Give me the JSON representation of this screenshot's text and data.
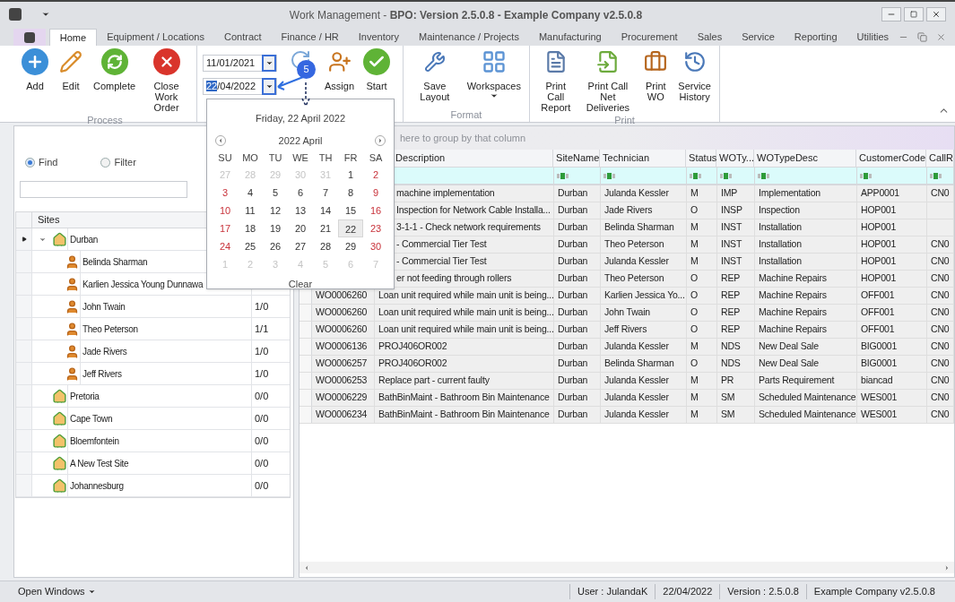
{
  "window": {
    "title": "Work Management - **BPO: Version 2.5.0.8 - Example Company v2.5.0.8**"
  },
  "tabs": [
    {
      "label": "Home",
      "selected": true
    },
    {
      "label": "Equipment / Locations",
      "selected": false
    },
    {
      "label": "Contract",
      "selected": false
    },
    {
      "label": "Finance / HR",
      "selected": false
    },
    {
      "label": "Inventory",
      "selected": false
    },
    {
      "label": "Maintenance / Projects",
      "selected": false
    },
    {
      "label": "Manufacturing",
      "selected": false
    },
    {
      "label": "Procurement",
      "selected": false
    },
    {
      "label": "Sales",
      "selected": false
    },
    {
      "label": "Service",
      "selected": false
    },
    {
      "label": "Reporting",
      "selected": false
    },
    {
      "label": "Utilities",
      "selected": false
    }
  ],
  "ribbon": {
    "process": {
      "label": "Process",
      "buttons": [
        "Add",
        "Edit",
        "Complete",
        "Close Work Order"
      ]
    },
    "dates": {
      "from": "11/01/2021",
      "to": "22/04/2022",
      "to_focused": true,
      "buttons": [
        "Assign",
        "Start"
      ]
    },
    "format": {
      "label": "Format",
      "buttons": [
        "Save Layout",
        "Workspaces"
      ]
    },
    "print": {
      "label": "Print",
      "buttons": [
        "Print Call Report",
        "Print Call Net Deliveries",
        "Print WO",
        "Service History"
      ]
    }
  },
  "callout": {
    "label": "5"
  },
  "search": {
    "options": [
      {
        "label": "Find",
        "selected": true
      },
      {
        "label": "Filter",
        "selected": false
      }
    ]
  },
  "tree": {
    "header": "Sites",
    "items": [
      {
        "name": "Durban",
        "expanded": true,
        "selected": true,
        "children": [
          {
            "name": "Belinda Sharman"
          },
          {
            "name": "Karlien Jessica Young Dunnawa"
          },
          {
            "name": "John Twain",
            "count": "1/0"
          },
          {
            "name": "Theo Peterson",
            "count": "1/1"
          },
          {
            "name": "Jade Rivers",
            "count": "1/0"
          },
          {
            "name": "Jeff Rivers",
            "count": "1/0"
          }
        ]
      },
      {
        "name": "Pretoria",
        "count": "0/0",
        "expanded": false,
        "selected": false
      },
      {
        "name": "Cape Town",
        "count": "0/0",
        "expanded": false,
        "selected": false
      },
      {
        "name": "Bloemfontein",
        "count": "0/0",
        "expanded": false,
        "selected": false
      },
      {
        "name": "A New Test Site",
        "count": "0/0",
        "expanded": false,
        "selected": false
      },
      {
        "name": "Johannesburg",
        "count": "0/0",
        "expanded": false,
        "selected": false
      }
    ]
  },
  "calendar": {
    "title": "Friday, 22 April 2022",
    "month": "2022 April",
    "weekdays": [
      "SU",
      "MO",
      "TU",
      "WE",
      "TH",
      "FR",
      "SA"
    ],
    "clear": "Clear",
    "weeks": [
      [
        {
          "d": "27",
          "kind": "other"
        },
        {
          "d": "28",
          "kind": "other"
        },
        {
          "d": "29",
          "kind": "other"
        },
        {
          "d": "30",
          "kind": "other"
        },
        {
          "d": "31",
          "kind": "other"
        },
        {
          "d": "1",
          "kind": "day"
        },
        {
          "d": "2",
          "kind": "weekend"
        }
      ],
      [
        {
          "d": "3",
          "kind": "weekend"
        },
        {
          "d": "4",
          "kind": "day"
        },
        {
          "d": "5",
          "kind": "day"
        },
        {
          "d": "6",
          "kind": "day"
        },
        {
          "d": "7",
          "kind": "day"
        },
        {
          "d": "8",
          "kind": "day"
        },
        {
          "d": "9",
          "kind": "weekend"
        }
      ],
      [
        {
          "d": "10",
          "kind": "weekend"
        },
        {
          "d": "11",
          "kind": "day"
        },
        {
          "d": "12",
          "kind": "day"
        },
        {
          "d": "13",
          "kind": "day"
        },
        {
          "d": "14",
          "kind": "day"
        },
        {
          "d": "15",
          "kind": "day"
        },
        {
          "d": "16",
          "kind": "weekend"
        }
      ],
      [
        {
          "d": "17",
          "kind": "weekend"
        },
        {
          "d": "18",
          "kind": "day"
        },
        {
          "d": "19",
          "kind": "day"
        },
        {
          "d": "20",
          "kind": "day"
        },
        {
          "d": "21",
          "kind": "day"
        },
        {
          "d": "22",
          "kind": "day",
          "selected": true
        },
        {
          "d": "23",
          "kind": "weekend"
        }
      ],
      [
        {
          "d": "24",
          "kind": "weekend"
        },
        {
          "d": "25",
          "kind": "day"
        },
        {
          "d": "26",
          "kind": "day"
        },
        {
          "d": "27",
          "kind": "day"
        },
        {
          "d": "28",
          "kind": "day"
        },
        {
          "d": "29",
          "kind": "day"
        },
        {
          "d": "30",
          "kind": "weekend"
        }
      ],
      [
        {
          "d": "1",
          "kind": "other"
        },
        {
          "d": "2",
          "kind": "other"
        },
        {
          "d": "3",
          "kind": "other"
        },
        {
          "d": "4",
          "kind": "other"
        },
        {
          "d": "5",
          "kind": "other"
        },
        {
          "d": "6",
          "kind": "other"
        },
        {
          "d": "7",
          "kind": "other"
        }
      ]
    ]
  },
  "grid": {
    "group_hint": "here to group by that column",
    "columns": [
      "Description",
      "SiteName",
      "Technician",
      "Status",
      "WOTy...",
      "WOTypeDesc",
      "CustomerCode",
      "CallR"
    ],
    "rows": [
      {
        "desc": "machine implementation",
        "site": "Durban",
        "tech": "Julanda Kessler",
        "status": "M",
        "type": "IMP",
        "type_desc": "Implementation",
        "customer": "APP0001",
        "call": "CN0"
      },
      {
        "desc": "Inspection for Network Cable Installa...",
        "site": "Durban",
        "tech": "Jade Rivers",
        "status": "O",
        "type": "INSP",
        "type_desc": "Inspection",
        "customer": "HOP001"
      },
      {
        "desc": "3-1-1 - Check network requirements",
        "site": "Durban",
        "tech": "Belinda Sharman",
        "status": "M",
        "type": "INST",
        "type_desc": "Installation",
        "customer": "HOP001"
      },
      {
        "desc": "- Commercial Tier Test",
        "site": "Durban",
        "tech": "Theo Peterson",
        "status": "M",
        "type": "INST",
        "type_desc": "Installation",
        "customer": "HOP001",
        "call": "CN0"
      },
      {
        "desc": "- Commercial Tier Test",
        "site": "Durban",
        "tech": "Julanda Kessler",
        "status": "M",
        "type": "INST",
        "type_desc": "Installation",
        "customer": "HOP001",
        "call": "CN0"
      },
      {
        "desc": "er not feeding through rollers",
        "site": "Durban",
        "tech": "Theo Peterson",
        "status": "O",
        "type": "REP",
        "type_desc": "Machine Repairs",
        "customer": "HOP001",
        "call": "CN0"
      },
      {
        "wo": "WO0006260",
        "desc": "Loan unit required while main unit is being...",
        "site": "Durban",
        "tech": "Karlien Jessica Yo...",
        "status": "O",
        "type": "REP",
        "type_desc": "Machine Repairs",
        "customer": "OFF001",
        "call": "CN0"
      },
      {
        "wo": "WO0006260",
        "desc": "Loan unit required while main unit is being...",
        "site": "Durban",
        "tech": "John Twain",
        "status": "O",
        "type": "REP",
        "type_desc": "Machine Repairs",
        "customer": "OFF001",
        "call": "CN0"
      },
      {
        "wo": "WO0006260",
        "desc": "Loan unit required while main unit is being...",
        "site": "Durban",
        "tech": "Jeff Rivers",
        "status": "O",
        "type": "REP",
        "type_desc": "Machine Repairs",
        "customer": "OFF001",
        "call": "CN0"
      },
      {
        "wo": "WO0006136",
        "desc": "PROJ406OR002",
        "site": "Durban",
        "tech": "Julanda Kessler",
        "status": "M",
        "type": "NDS",
        "type_desc": "New Deal Sale",
        "customer": "BIG0001",
        "call": "CN0"
      },
      {
        "wo": "WO0006257",
        "desc": "PROJ406OR002",
        "site": "Durban",
        "tech": "Belinda Sharman",
        "status": "O",
        "type": "NDS",
        "type_desc": "New Deal Sale",
        "customer": "BIG0001",
        "call": "CN0"
      },
      {
        "wo": "WO0006253",
        "desc": "Replace part - current faulty",
        "site": "Durban",
        "tech": "Julanda Kessler",
        "status": "M",
        "type": "PR",
        "type_desc": "Parts Requirement",
        "customer": "biancad",
        "call": "CN0"
      },
      {
        "wo": "WO0006229",
        "desc": "BathBinMaint - Bathroom Bin Maintenance",
        "site": "Durban",
        "tech": "Julanda Kessler",
        "status": "M",
        "type": "SM",
        "type_desc": "Scheduled Maintenance",
        "customer": "WES001",
        "call": "CN0"
      },
      {
        "wo": "WO0006234",
        "desc": "BathBinMaint - Bathroom Bin Maintenance",
        "site": "Durban",
        "tech": "Julanda Kessler",
        "status": "M",
        "type": "SM",
        "type_desc": "Scheduled Maintenance",
        "customer": "WES001",
        "call": "CN0"
      }
    ]
  },
  "status_bar": {
    "left": "Open Windows",
    "items": [
      "User : JulandaK",
      "22/04/2022",
      "Version : 2.5.0.8",
      "Example Company v2.5.0.8"
    ]
  }
}
